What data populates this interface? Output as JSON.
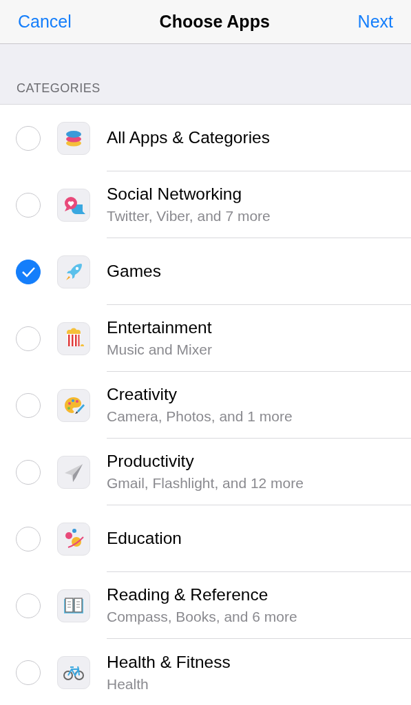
{
  "nav_bar": {
    "cancel": "Cancel",
    "title": "Choose Apps",
    "next": "Next"
  },
  "section_header": "CATEGORIES",
  "categories": [
    {
      "title": "All Apps & Categories",
      "selected": false
    },
    {
      "title": "Social Networking",
      "subtitle": "Twitter, Viber, and 7 more",
      "selected": false
    },
    {
      "title": "Games",
      "selected": true
    },
    {
      "title": "Entertainment",
      "subtitle": "Music and Mixer",
      "selected": false
    },
    {
      "title": "Creativity",
      "subtitle": "Camera, Photos, and 1 more",
      "selected": false
    },
    {
      "title": "Productivity",
      "subtitle": "Gmail, Flashlight, and 12 more",
      "selected": false
    },
    {
      "title": "Education",
      "selected": false
    },
    {
      "title": "Reading & Reference",
      "subtitle": "Compass, Books, and 6 more",
      "selected": false
    },
    {
      "title": "Health & Fitness",
      "subtitle": "Health",
      "selected": false
    }
  ]
}
